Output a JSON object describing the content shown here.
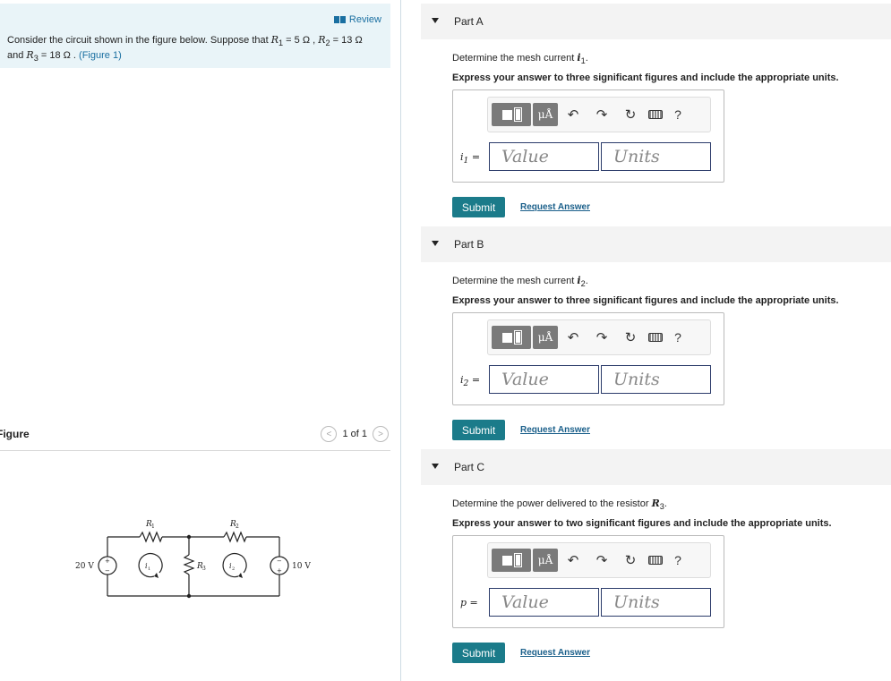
{
  "review": {
    "label": "Review"
  },
  "problem": {
    "intro": "Consider the circuit shown in the figure below. Suppose that",
    "r1_sym": "R",
    "r1_sub": "1",
    "r1_val": " = 5 Ω ,",
    "r2_sym": "R",
    "r2_sub": "2",
    "r2_val": " = 13 Ω",
    "and": "and",
    "r3_sym": "R",
    "r3_sub": "3",
    "r3_val": " = 18 Ω .",
    "figure_link": "(Figure 1)"
  },
  "figure": {
    "title": "Figure",
    "pager": "1 of 1",
    "prev": "<",
    "next": ">",
    "labels": {
      "v20": "20 V",
      "v10": "10 V",
      "r1": "R",
      "r1_sub": "1",
      "r2": "R",
      "r2_sub": "2",
      "r3": "R",
      "r3_sub": "3",
      "i1": "i",
      "i1_sub": "1",
      "i2": "i",
      "i2_sub": "2",
      "plus": "+",
      "minus": "−"
    }
  },
  "toolbar": {
    "units_symbol": "μÅ",
    "undo": "↶",
    "redo": "↷",
    "reset": "↻",
    "help": "?"
  },
  "parts": [
    {
      "title": "Part A",
      "prompt": "Determine the mesh current",
      "var": "i",
      "var_sub": "1",
      "prompt_end": ".",
      "instructions": "Express your answer to three significant figures and include the appropriate units.",
      "label": "i",
      "label_sub": "1",
      "label_eq": " =",
      "value_placeholder": "Value",
      "units_placeholder": "Units",
      "submit": "Submit",
      "request": "Request Answer"
    },
    {
      "title": "Part B",
      "prompt": "Determine the mesh current",
      "var": "i",
      "var_sub": "2",
      "prompt_end": ".",
      "instructions": "Express your answer to three significant figures and include the appropriate units.",
      "label": "i",
      "label_sub": "2",
      "label_eq": " =",
      "value_placeholder": "Value",
      "units_placeholder": "Units",
      "submit": "Submit",
      "request": "Request Answer"
    },
    {
      "title": "Part C",
      "prompt": "Determine the power delivered to the resistor",
      "var": "R",
      "var_sub": "3",
      "prompt_end": ".",
      "instructions": "Express your answer to two significant figures and include the appropriate units.",
      "label": "p",
      "label_sub": "",
      "label_eq": " =",
      "value_placeholder": "Value",
      "units_placeholder": "Units",
      "submit": "Submit",
      "request": "Request Answer"
    }
  ]
}
